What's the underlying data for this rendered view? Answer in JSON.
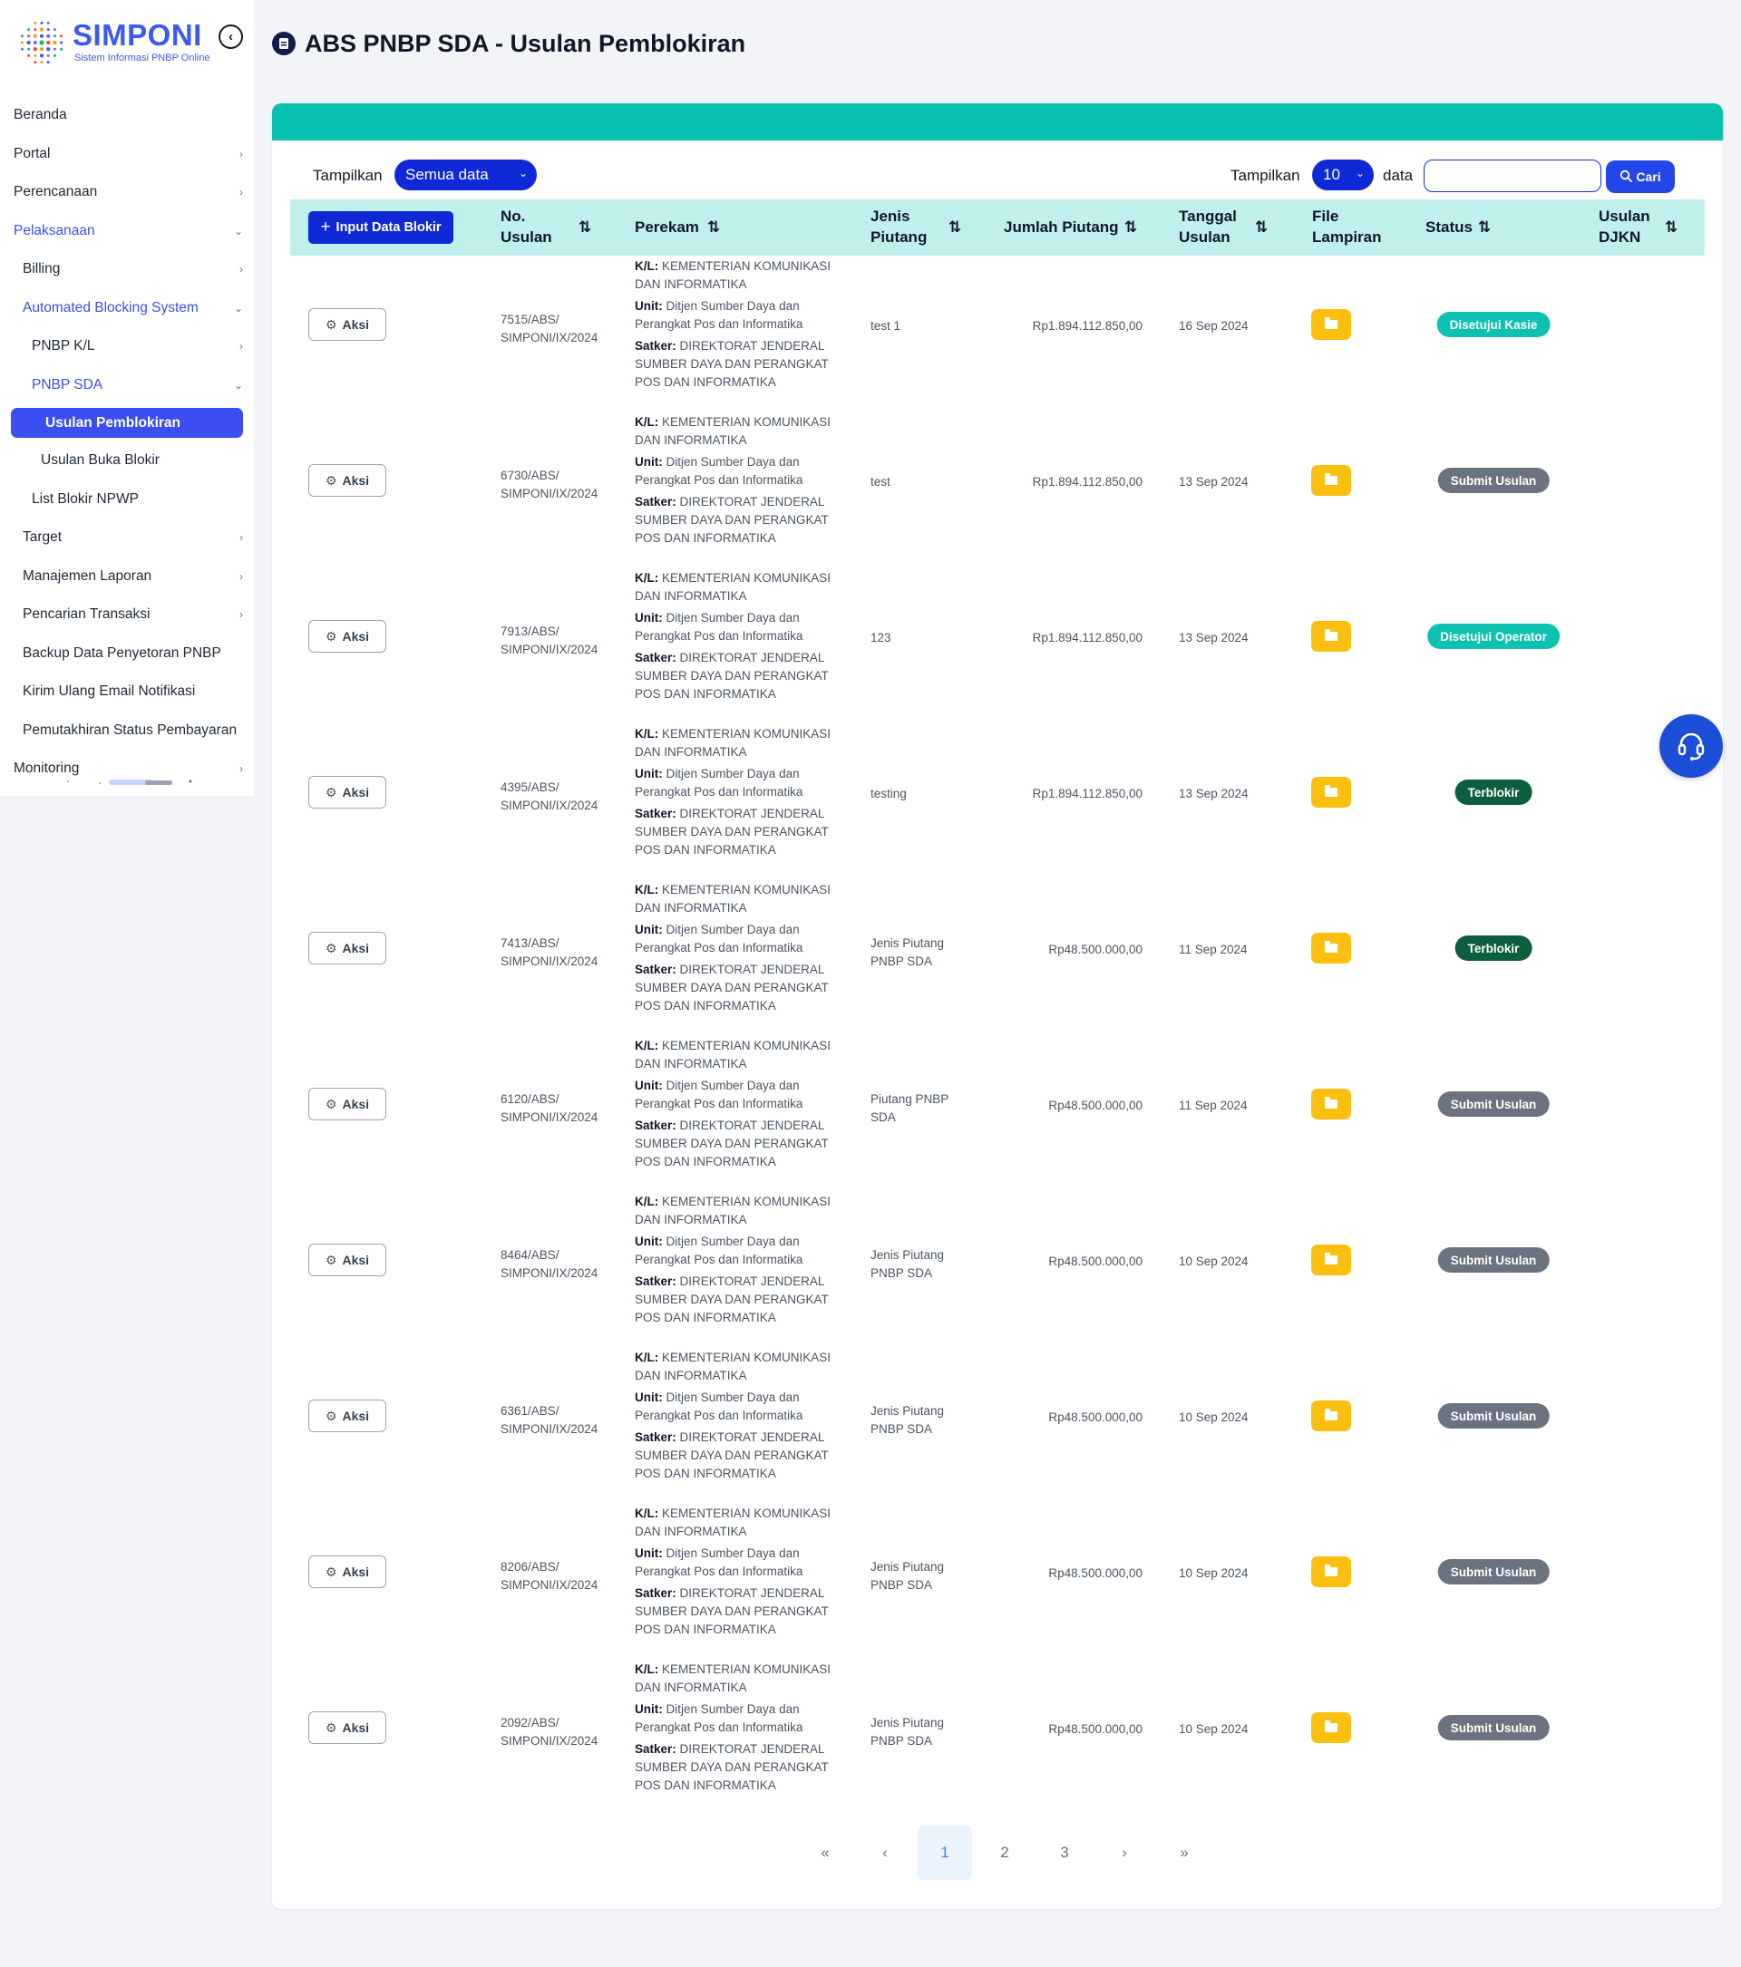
{
  "brand": {
    "name": "SIMPONI",
    "subtitle": "Sistem Informasi PNBP Online"
  },
  "sidebar": {
    "items": [
      {
        "label": "Beranda",
        "level": 0,
        "chevron": "",
        "state": ""
      },
      {
        "label": "Portal",
        "level": 0,
        "chevron": "›",
        "state": ""
      },
      {
        "label": "Perencanaan",
        "level": 0,
        "chevron": "›",
        "state": ""
      },
      {
        "label": "Pelaksanaan",
        "level": 0,
        "chevron": "⌄",
        "state": "active"
      },
      {
        "label": "Billing",
        "level": 1,
        "chevron": "›",
        "state": ""
      },
      {
        "label": "Automated Blocking System",
        "level": 1,
        "chevron": "⌄",
        "state": "active"
      },
      {
        "label": "PNBP K/L",
        "level": 2,
        "chevron": "›",
        "state": ""
      },
      {
        "label": "PNBP SDA",
        "level": 2,
        "chevron": "⌄",
        "state": "active"
      },
      {
        "label": "Usulan Pemblokiran",
        "level": 3,
        "chevron": "",
        "state": "selected"
      },
      {
        "label": "Usulan Buka Blokir",
        "level": 3,
        "chevron": "",
        "state": ""
      },
      {
        "label": "List Blokir NPWP",
        "level": 2,
        "chevron": "",
        "state": ""
      },
      {
        "label": "Target",
        "level": 1,
        "chevron": "›",
        "state": ""
      },
      {
        "label": "Manajemen Laporan",
        "level": 1,
        "chevron": "›",
        "state": ""
      },
      {
        "label": "Pencarian Transaksi",
        "level": 1,
        "chevron": "›",
        "state": ""
      },
      {
        "label": "Backup Data Penyetoran PNBP",
        "level": 1,
        "chevron": "",
        "state": ""
      },
      {
        "label": "Kirim Ulang Email Notifikasi",
        "level": 1,
        "chevron": "",
        "state": ""
      },
      {
        "label": "Pemutakhiran Status Pembayaran",
        "level": 1,
        "chevron": "",
        "state": ""
      },
      {
        "label": "Monitoring",
        "level": 0,
        "chevron": "›",
        "state": ""
      }
    ]
  },
  "header": {
    "title": "ABS PNBP SDA - Usulan Pemblokiran"
  },
  "controls": {
    "tampilkan_label": "Tampilkan",
    "filter_value": "Semua data",
    "tampilkan_label2": "Tampilkan",
    "page_size": "10",
    "data_label": "data",
    "search_value": "",
    "search_placeholder": "",
    "search_button": "Cari"
  },
  "table": {
    "add_button": "Input Data Blokir",
    "columns": {
      "no_usulan": [
        "No.",
        "Usulan"
      ],
      "perekam": "Perekam",
      "jenis_piutang": [
        "Jenis",
        "Piutang"
      ],
      "jumlah_piutang": "Jumlah Piutang",
      "tanggal_usulan": [
        "Tanggal",
        "Usulan"
      ],
      "file_lampiran": [
        "File",
        "Lampiran"
      ],
      "status": "Status",
      "usulan_djkn": [
        "Usulan",
        "DJKN"
      ]
    },
    "aksi_label": "Aksi",
    "perekam_labels": {
      "kl": "K/L",
      "unit": "Unit",
      "satker": "Satker"
    },
    "rows": [
      {
        "no": [
          "7515/ABS/",
          "SIMPONI/IX/2024"
        ],
        "kl": "KEMENTERIAN KOMUNIKASI DAN INFORMATIKA",
        "unit": "Ditjen Sumber Daya dan Perangkat Pos dan Informatika",
        "satker": "DIREKTORAT JENDERAL SUMBER DAYA DAN PERANGKAT POS DAN INFORMATIKA",
        "jenis": [
          "test 1"
        ],
        "jumlah": "Rp1.894.112.850,00",
        "tanggal": "16 Sep 2024",
        "status": "Disetujui Kasie",
        "status_color": "#0ec2b1",
        "djkn": ""
      },
      {
        "no": [
          "6730/ABS/",
          "SIMPONI/IX/2024"
        ],
        "kl": "KEMENTERIAN KOMUNIKASI DAN INFORMATIKA",
        "unit": "Ditjen Sumber Daya dan Perangkat Pos dan Informatika",
        "satker": "DIREKTORAT JENDERAL SUMBER DAYA DAN PERANGKAT POS DAN INFORMATIKA",
        "jenis": [
          "test"
        ],
        "jumlah": "Rp1.894.112.850,00",
        "tanggal": "13 Sep 2024",
        "status": "Submit Usulan",
        "status_color": "#6b7280",
        "djkn": ""
      },
      {
        "no": [
          "7913/ABS/",
          "SIMPONI/IX/2024"
        ],
        "kl": "KEMENTERIAN KOMUNIKASI DAN INFORMATIKA",
        "unit": "Ditjen Sumber Daya dan Perangkat Pos dan Informatika",
        "satker": "DIREKTORAT JENDERAL SUMBER DAYA DAN PERANGKAT POS DAN INFORMATIKA",
        "jenis": [
          "123"
        ],
        "jumlah": "Rp1.894.112.850,00",
        "tanggal": "13 Sep 2024",
        "status": "Disetujui Operator",
        "status_color": "#0ec2b1",
        "djkn": ""
      },
      {
        "no": [
          "4395/ABS/",
          "SIMPONI/IX/2024"
        ],
        "kl": "KEMENTERIAN KOMUNIKASI DAN INFORMATIKA",
        "unit": "Ditjen Sumber Daya dan Perangkat Pos dan Informatika",
        "satker": "DIREKTORAT JENDERAL SUMBER DAYA DAN PERANGKAT POS DAN INFORMATIKA",
        "jenis": [
          "testing"
        ],
        "jumlah": "Rp1.894.112.850,00",
        "tanggal": "13 Sep 2024",
        "status": "Terblokir",
        "status_color": "#0d5e3f",
        "djkn": ""
      },
      {
        "no": [
          "7413/ABS/",
          "SIMPONI/IX/2024"
        ],
        "kl": "KEMENTERIAN KOMUNIKASI DAN INFORMATIKA",
        "unit": "Ditjen Sumber Daya dan Perangkat Pos dan Informatika",
        "satker": "DIREKTORAT JENDERAL SUMBER DAYA DAN PERANGKAT POS DAN INFORMATIKA",
        "jenis": [
          "Jenis Piutang",
          "PNBP SDA"
        ],
        "jumlah": "Rp48.500.000,00",
        "tanggal": "11 Sep 2024",
        "status": "Terblokir",
        "status_color": "#0d5e3f",
        "djkn": ""
      },
      {
        "no": [
          "6120/ABS/",
          "SIMPONI/IX/2024"
        ],
        "kl": "KEMENTERIAN KOMUNIKASI DAN INFORMATIKA",
        "unit": "Ditjen Sumber Daya dan Perangkat Pos dan Informatika",
        "satker": "DIREKTORAT JENDERAL SUMBER DAYA DAN PERANGKAT POS DAN INFORMATIKA",
        "jenis": [
          "Piutang PNBP",
          "SDA"
        ],
        "jumlah": "Rp48.500.000,00",
        "tanggal": "11 Sep 2024",
        "status": "Submit Usulan",
        "status_color": "#6b7280",
        "djkn": ""
      },
      {
        "no": [
          "8464/ABS/",
          "SIMPONI/IX/2024"
        ],
        "kl": "KEMENTERIAN KOMUNIKASI DAN INFORMATIKA",
        "unit": "Ditjen Sumber Daya dan Perangkat Pos dan Informatika",
        "satker": "DIREKTORAT JENDERAL SUMBER DAYA DAN PERANGKAT POS DAN INFORMATIKA",
        "jenis": [
          "Jenis Piutang",
          "PNBP SDA"
        ],
        "jumlah": "Rp48.500.000,00",
        "tanggal": "10 Sep 2024",
        "status": "Submit Usulan",
        "status_color": "#6b7280",
        "djkn": ""
      },
      {
        "no": [
          "6361/ABS/",
          "SIMPONI/IX/2024"
        ],
        "kl": "KEMENTERIAN KOMUNIKASI DAN INFORMATIKA",
        "unit": "Ditjen Sumber Daya dan Perangkat Pos dan Informatika",
        "satker": "DIREKTORAT JENDERAL SUMBER DAYA DAN PERANGKAT POS DAN INFORMATIKA",
        "jenis": [
          "Jenis Piutang",
          "PNBP SDA"
        ],
        "jumlah": "Rp48.500.000,00",
        "tanggal": "10 Sep 2024",
        "status": "Submit Usulan",
        "status_color": "#6b7280",
        "djkn": ""
      },
      {
        "no": [
          "8206/ABS/",
          "SIMPONI/IX/2024"
        ],
        "kl": "KEMENTERIAN KOMUNIKASI DAN INFORMATIKA",
        "unit": "Ditjen Sumber Daya dan Perangkat Pos dan Informatika",
        "satker": "DIREKTORAT JENDERAL SUMBER DAYA DAN PERANGKAT POS DAN INFORMATIKA",
        "jenis": [
          "Jenis Piutang",
          "PNBP SDA"
        ],
        "jumlah": "Rp48.500.000,00",
        "tanggal": "10 Sep 2024",
        "status": "Submit Usulan",
        "status_color": "#6b7280",
        "djkn": ""
      },
      {
        "no": [
          "2092/ABS/",
          "SIMPONI/IX/2024"
        ],
        "kl": "KEMENTERIAN KOMUNIKASI DAN INFORMATIKA",
        "unit": "Ditjen Sumber Daya dan Perangkat Pos dan Informatika",
        "satker": "DIREKTORAT JENDERAL SUMBER DAYA DAN PERANGKAT POS DAN INFORMATIKA",
        "jenis": [
          "Jenis Piutang",
          "PNBP SDA"
        ],
        "jumlah": "Rp48.500.000,00",
        "tanggal": "10 Sep 2024",
        "status": "Submit Usulan",
        "status_color": "#6b7280",
        "djkn": ""
      }
    ]
  },
  "pagination": {
    "items": [
      {
        "label": "«",
        "name": "page-first-button",
        "current": false
      },
      {
        "label": "‹",
        "name": "page-prev-button",
        "current": false
      },
      {
        "label": "1",
        "name": "page-1-button",
        "current": true
      },
      {
        "label": "2",
        "name": "page-2-button",
        "current": false
      },
      {
        "label": "3",
        "name": "page-3-button",
        "current": false
      },
      {
        "label": "›",
        "name": "page-next-button",
        "current": false
      },
      {
        "label": "»",
        "name": "page-last-button",
        "current": false
      }
    ]
  },
  "icons": {
    "logo": "simponi-logo-icon",
    "collapse": "chevron-left-circle-icon",
    "title": "document-icon",
    "search": "search-icon",
    "add": "plus-icon",
    "aksi": "gear-icon",
    "folder": "folder-icon",
    "sort": "sort-icon",
    "help": "headset-icon"
  },
  "colors": {
    "accent": "#1029d6",
    "teal_strip": "#08c1b1",
    "table_header": "#bff0ec",
    "folder": "#fbbf0f",
    "sidebar_active": "#3b4ef2"
  }
}
